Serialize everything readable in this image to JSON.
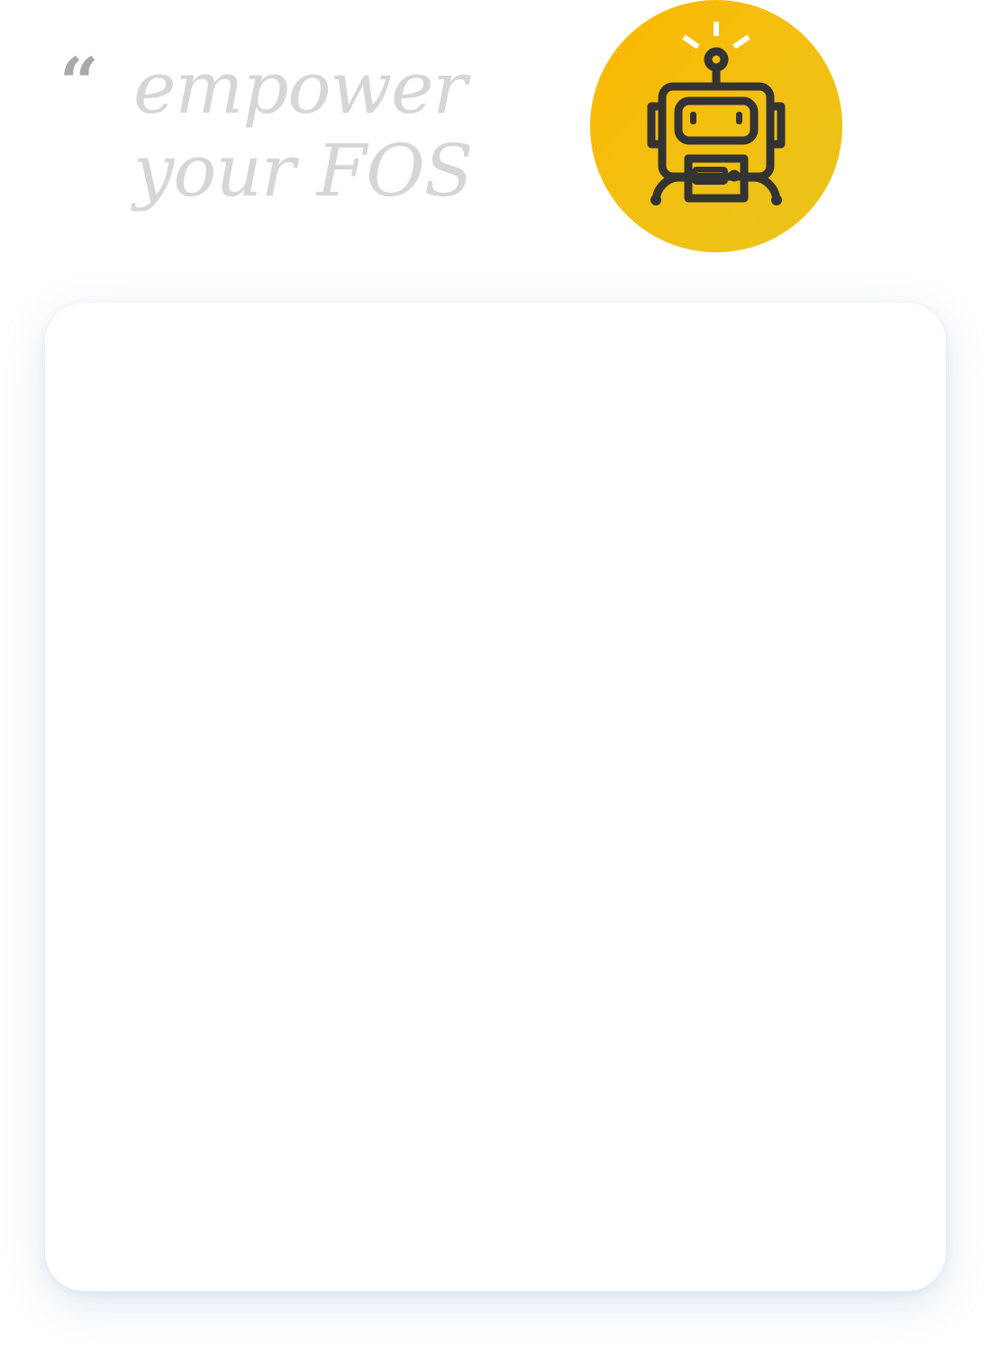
{
  "hero": {
    "quote_glyph": "“",
    "tagline_line1": "empower",
    "tagline_line2": "your FOS",
    "badge_icon": "robot-icon",
    "colors": {
      "tagline": "#d6d6d6",
      "quote_mark": "#a9a9a9",
      "badge_start": "#fbb800",
      "badge_end": "#e8c41c",
      "icon_stroke": "#333333",
      "spark": "#ffffff"
    }
  },
  "main_card": {
    "background": "#ffffff"
  }
}
